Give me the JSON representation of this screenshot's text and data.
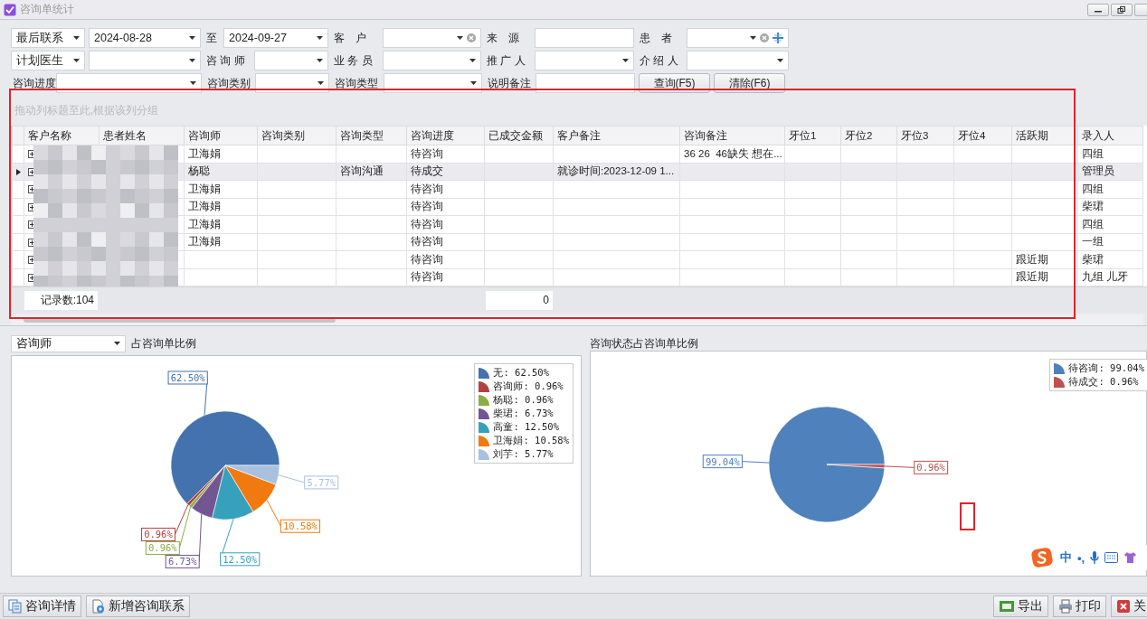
{
  "window": {
    "title": "咨询单统计"
  },
  "filters": [
    {
      "items": [
        {
          "kind": "select",
          "value": "最后联系"
        },
        {
          "kind": "date",
          "value": "2024-08-28"
        },
        {
          "kind": "label",
          "text": "至"
        },
        {
          "kind": "date",
          "value": "2024-09-27"
        },
        {
          "kind": "label",
          "text": "客　户"
        },
        {
          "kind": "combo",
          "clearable": true,
          "addable": false
        },
        {
          "kind": "label",
          "text": "来　源"
        },
        {
          "kind": "input"
        },
        {
          "kind": "label",
          "text": "患　者"
        },
        {
          "kind": "combo",
          "clearable": true,
          "addable": true
        }
      ]
    },
    {
      "items": [
        {
          "kind": "select",
          "value": "计划医生"
        },
        {
          "kind": "select"
        },
        {
          "kind": "label",
          "text": "咨 询 师"
        },
        {
          "kind": "select"
        },
        {
          "kind": "label",
          "text": "业 务 员"
        },
        {
          "kind": "select"
        },
        {
          "kind": "label",
          "text": "推 广 人"
        },
        {
          "kind": "select"
        },
        {
          "kind": "label",
          "text": "介 绍 人"
        },
        {
          "kind": "select"
        }
      ]
    },
    {
      "items": [
        {
          "kind": "label",
          "text": "咨询进度"
        },
        {
          "kind": "select"
        },
        {
          "kind": "label",
          "text": "咨询类别"
        },
        {
          "kind": "select"
        },
        {
          "kind": "label",
          "text": "咨询类型"
        },
        {
          "kind": "select"
        },
        {
          "kind": "label",
          "text": "说明备注"
        },
        {
          "kind": "input"
        },
        {
          "kind": "button",
          "text": "查询(F5)"
        },
        {
          "kind": "button",
          "text": "清除(F6)"
        }
      ]
    }
  ],
  "grid": {
    "group_hint": "拖动列标题至此,根据该列分组",
    "columns": [
      "客户名称",
      "患者姓名",
      "咨询师",
      "咨询类别",
      "咨询类型",
      "咨询进度",
      "已成交金额",
      "客户备注",
      "咨询备注",
      "牙位1",
      "牙位2",
      "牙位3",
      "牙位4",
      "活跃期",
      "录入人"
    ],
    "rows": [
      {
        "selected": false,
        "expanded": false,
        "cells": [
          null,
          null,
          "卫海娟",
          null,
          null,
          "待咨询",
          null,
          null,
          "36 26  46缺失 想在...",
          null,
          null,
          null,
          null,
          null,
          "四组"
        ]
      },
      {
        "selected": true,
        "expanded": false,
        "cells": [
          null,
          null,
          "杨聪",
          null,
          "咨询沟通",
          "待成交",
          null,
          "就诊时间:2023-12-09 1...",
          null,
          null,
          null,
          null,
          null,
          null,
          "管理员"
        ]
      },
      {
        "selected": false,
        "expanded": false,
        "cells": [
          null,
          null,
          "卫海娟",
          null,
          null,
          "待咨询",
          null,
          null,
          null,
          null,
          null,
          null,
          null,
          null,
          "四组"
        ]
      },
      {
        "selected": false,
        "expanded": false,
        "cells": [
          null,
          null,
          "卫海娟",
          null,
          null,
          "待咨询",
          null,
          null,
          null,
          null,
          null,
          null,
          null,
          null,
          "柴珺"
        ]
      },
      {
        "selected": false,
        "expanded": false,
        "cells": [
          null,
          null,
          "卫海娟",
          null,
          null,
          "待咨询",
          null,
          null,
          null,
          null,
          null,
          null,
          null,
          null,
          "四组"
        ]
      },
      {
        "selected": false,
        "expanded": false,
        "cells": [
          null,
          null,
          "卫海娟",
          null,
          null,
          "待咨询",
          null,
          null,
          null,
          null,
          null,
          null,
          null,
          null,
          "一组"
        ]
      },
      {
        "selected": false,
        "expanded": false,
        "cells": [
          null,
          null,
          null,
          null,
          null,
          "待咨询",
          null,
          null,
          null,
          null,
          null,
          null,
          null,
          "跟近期",
          "柴珺"
        ]
      },
      {
        "selected": false,
        "expanded": false,
        "cells": [
          null,
          null,
          null,
          null,
          null,
          "待咨询",
          null,
          null,
          null,
          null,
          null,
          null,
          null,
          "跟近期",
          "九组 儿牙"
        ]
      }
    ],
    "footer": {
      "record_count": "记录数:104",
      "amount_total": "0"
    }
  },
  "charts": [
    {
      "selector": "咨询师",
      "caption": "占咨询单比例",
      "chart_data": {
        "type": "pie",
        "categories": [
          "无: 62.50%",
          "咨询师: 0.96%",
          "杨聪: 0.96%",
          "柴珺: 6.73%",
          "高童: 12.50%",
          "卫海娟: 10.58%",
          "刘芋: 5.77%"
        ],
        "series": [
          {
            "values": [
              62.5,
              0.96,
              0.96,
              6.73,
              12.5,
              10.58,
              5.77
            ]
          }
        ],
        "legend": "top-right",
        "value_labels": [
          "62.50%",
          "0.96%",
          "0.96%",
          "6.73%",
          "12.50%",
          "10.58%",
          "5.77%"
        ]
      }
    },
    {
      "caption": "咨询状态占咨询单比例",
      "chart_data": {
        "type": "pie",
        "categories": [
          "待咨询: 99.04%",
          "待成交: 0.96%"
        ],
        "series": [
          {
            "values": [
              99.04,
              0.96
            ]
          }
        ],
        "legend": "top-right",
        "value_labels": [
          "99.04%",
          "0.96%"
        ]
      }
    }
  ],
  "ime_toolbar": {
    "mode": "中",
    "punctuation": "•,"
  },
  "bottom_bar": {
    "left": [
      {
        "kind": "details",
        "label": "咨询详情"
      },
      {
        "kind": "add",
        "label": "新增咨询联系"
      }
    ],
    "right": [
      {
        "kind": "export",
        "label": "导出"
      },
      {
        "kind": "print",
        "label": "打印"
      },
      {
        "kind": "close",
        "label": "关"
      }
    ]
  }
}
